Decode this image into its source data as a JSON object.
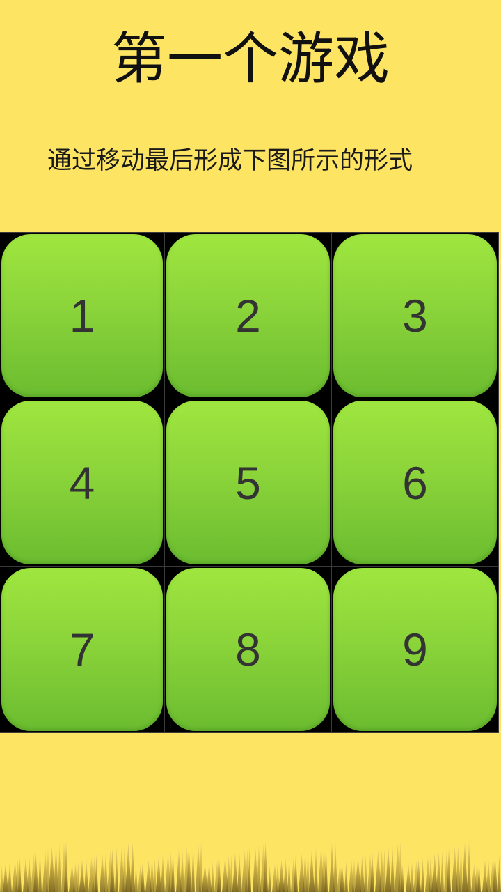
{
  "header": {
    "title": "第一个游戏",
    "instruction": "通过移动最后形成下图所示的形式"
  },
  "board": {
    "tiles": [
      "1",
      "2",
      "3",
      "4",
      "5",
      "6",
      "7",
      "8",
      "9"
    ]
  },
  "colors": {
    "background": "#FEE463",
    "tile_top": "#9fe63f",
    "tile_bottom": "#6bbc30",
    "grid": "#000000",
    "number": "#333333"
  }
}
